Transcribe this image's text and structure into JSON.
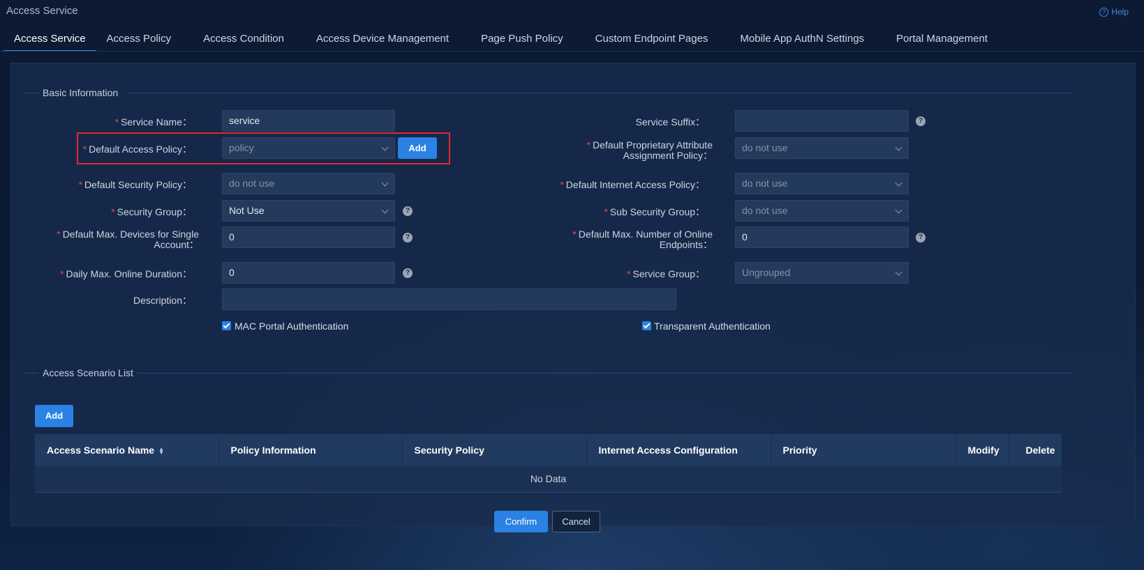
{
  "app": {
    "title": "Access Service",
    "help_label": "Help"
  },
  "tabs": [
    {
      "label": "Access Service",
      "active": true
    },
    {
      "label": "Access Policy"
    },
    {
      "label": "Access Condition"
    },
    {
      "label": "Access Device Management"
    },
    {
      "label": "Page Push Policy"
    },
    {
      "label": "Custom Endpoint Pages"
    },
    {
      "label": "Mobile App AuthN Settings"
    },
    {
      "label": "Portal Management"
    }
  ],
  "basic": {
    "title": "Basic Information",
    "required_mark": "*",
    "service_name": {
      "label": "Service Name：",
      "value": "service"
    },
    "default_access_policy": {
      "label": "Default Access Policy：",
      "value": "policy",
      "add_label": "Add"
    },
    "default_security_policy": {
      "label": "Default Security Policy：",
      "value": "do not use"
    },
    "security_group": {
      "label": "Security Group：",
      "value": "Not Use"
    },
    "max_devices": {
      "label_line1": "Default Max. Devices for Single",
      "label_line2": "Account：",
      "value": "0"
    },
    "daily_max_online": {
      "label": "Daily Max. Online Duration：",
      "value": "0"
    },
    "description": {
      "label": "Description：",
      "value": ""
    },
    "service_suffix": {
      "label": "Service Suffix：",
      "value": ""
    },
    "proprietary_policy": {
      "label_line1": "Default Proprietary Attribute",
      "label_line2": "Assignment Policy：",
      "value": "do not use"
    },
    "internet_access_policy": {
      "label": "Default Internet Access Policy：",
      "value": "do not use"
    },
    "sub_security_group": {
      "label": "Sub Security Group：",
      "value": "do not use"
    },
    "max_online_endpoints": {
      "label_line1": "Default Max. Number of Online",
      "label_line2": "Endpoints：",
      "value": "0"
    },
    "service_group": {
      "label": "Service Group：",
      "value": "Ungrouped"
    },
    "mac_portal_auth": {
      "label": "MAC Portal Authentication",
      "checked": true
    },
    "transparent_auth": {
      "label": "Transparent Authentication",
      "checked": true
    },
    "help_glyph": "?"
  },
  "scenario": {
    "title": "Access Scenario List",
    "add_label": "Add",
    "columns": [
      "Access Scenario Name",
      "Policy Information",
      "Security Policy",
      "Internet Access Configuration",
      "Priority",
      "Modify",
      "Delete"
    ],
    "empty_text": "No Data"
  },
  "footer": {
    "confirm_label": "Confirm",
    "cancel_label": "Cancel"
  },
  "colors": {
    "accent": "#2a82e4",
    "required": "#e34b4b",
    "highlight": "#e5282e"
  }
}
